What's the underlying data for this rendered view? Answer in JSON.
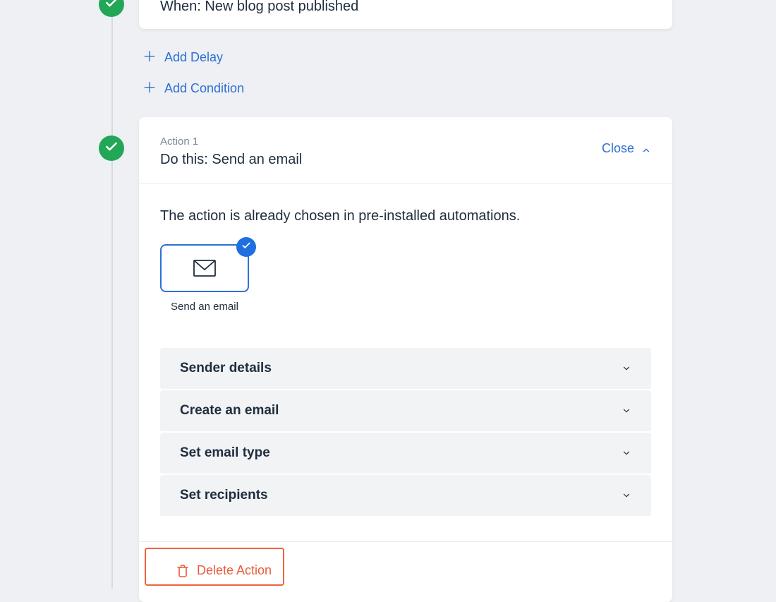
{
  "trigger": {
    "title": "When: New blog post published"
  },
  "add_links": {
    "delay": "Add Delay",
    "condition": "Add Condition"
  },
  "action": {
    "label": "Action 1",
    "title": "Do this: Send an email",
    "close_label": "Close",
    "info_text": "The action is already chosen in pre-installed automations.",
    "chip_label": "Send an email",
    "accordion": {
      "sender_details": "Sender details",
      "create_email": "Create an email",
      "set_type": "Set email type",
      "set_recipients": "Set recipients"
    },
    "delete_label": "Delete Action"
  },
  "colors": {
    "accent_blue": "#2e6fd6",
    "success_green": "#21a756",
    "danger_orange": "#e85c3b",
    "highlight_border": "#f0643d"
  }
}
